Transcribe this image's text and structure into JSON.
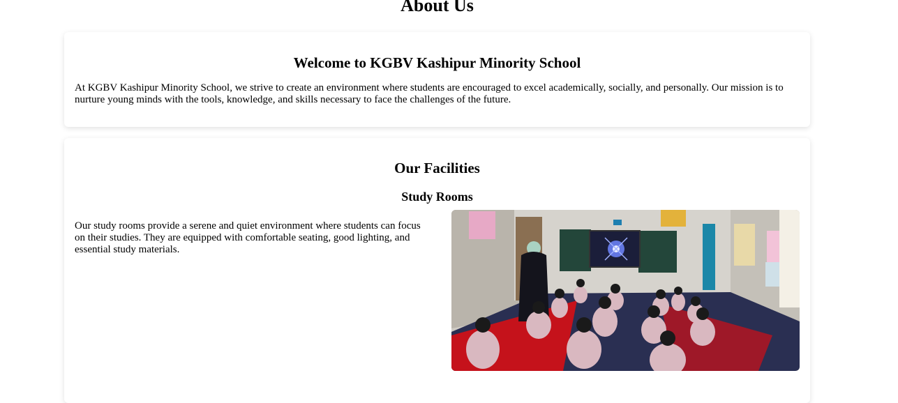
{
  "page": {
    "title": "About Us"
  },
  "welcome": {
    "heading": "Welcome to KGBV Kashipur Minority School",
    "text": "At KGBV Kashipur Minority School, we strive to create an environment where students are encouraged to excel academically, socially, and personally. Our mission is to nurture young minds with the tools, knowledge, and skills necessary to face the challenges of the future."
  },
  "facilities": {
    "heading": "Our Facilities",
    "study_rooms": {
      "heading": "Study Rooms",
      "text": "Our study rooms provide a serene and quiet environment where students can focus on their studies. They are equipped with comfortable seating, good lighting, and essential study materials."
    }
  }
}
